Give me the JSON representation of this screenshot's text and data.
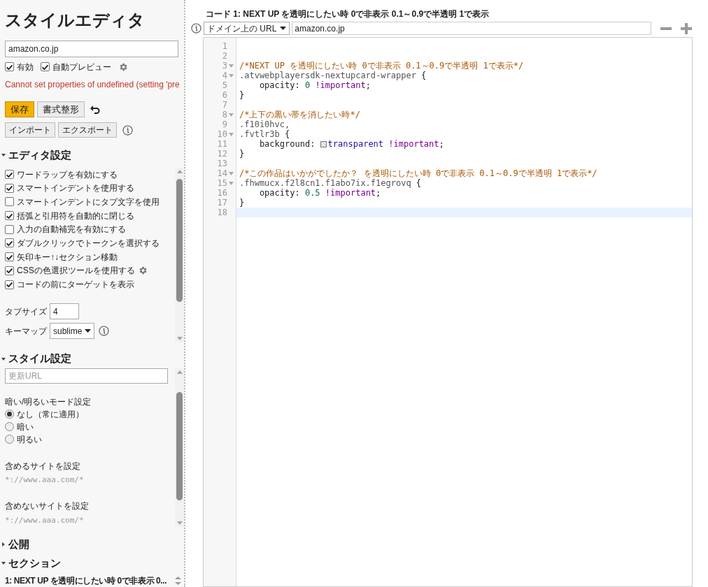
{
  "sidebar": {
    "title": "スタイルエディタ",
    "name_value": "amazon.co.jp",
    "toggles": [
      {
        "label": "有効",
        "checked": true
      },
      {
        "label": "自動プレビュー",
        "checked": true
      }
    ],
    "error": "Cannot set properties of undefined (setting 'pre",
    "buttons": [
      {
        "label": "保存",
        "kind": "primary"
      },
      {
        "label": "書式整形",
        "kind": "normal"
      }
    ],
    "io_buttons": [
      "インポート",
      "エクスポート"
    ],
    "editor_settings": {
      "title": "エディタ設定",
      "expanded": true,
      "options": [
        {
          "label": "ワードラップを有効にする",
          "checked": true,
          "gear": false
        },
        {
          "label": "スマートインデントを使用する",
          "checked": true,
          "gear": false
        },
        {
          "label": "スマートインデントにタブ文字を使用",
          "checked": false,
          "gear": false
        },
        {
          "label": "括弧と引用符を自動的に閉じる",
          "checked": true,
          "gear": false
        },
        {
          "label": "入力の自動補完を有効にする",
          "checked": false,
          "gear": false
        },
        {
          "label": "ダブルクリックでトークンを選択する",
          "checked": true,
          "gear": false
        },
        {
          "label": "矢印キー↑↓セクション移動",
          "checked": true,
          "gear": false
        },
        {
          "label": "CSSの色選択ツールを使用する",
          "checked": true,
          "gear": true
        },
        {
          "label": "コードの前にターゲットを表示",
          "checked": true,
          "gear": false
        }
      ],
      "tab_size_label": "タブサイズ",
      "tab_size": "4",
      "keymap_label": "キーマップ",
      "keymap": "sublime"
    },
    "style_settings": {
      "title": "スタイル設定",
      "expanded": true,
      "update_url_placeholder": "更新URL",
      "mode_label": "暗い/明るいモード設定",
      "modes": [
        {
          "label": "なし（常に適用）",
          "selected": true
        },
        {
          "label": "暗い",
          "selected": false
        },
        {
          "label": "明るい",
          "selected": false
        }
      ],
      "include_label": "含めるサイトを設定",
      "include_placeholder": "*://www.aaa.com/*",
      "exclude_label": "含めないサイトを設定",
      "exclude_placeholder": "*://www.aaa.com/*"
    },
    "publish": {
      "title": "公開",
      "expanded": false
    },
    "sections": {
      "title": "セクション",
      "expanded": true,
      "items": [
        "1: NEXT UP を透明にしたい時 0で非表示 0..."
      ]
    }
  },
  "editor": {
    "title": "コード 1: NEXT UP を透明にしたい時 0で非表示 0.1～0.9で半透明 1で表示",
    "applies_type": "ドメイン上の URL",
    "applies_value": "amazon.co.jp",
    "lines": [
      {
        "number": "1",
        "foldable": false,
        "active": false
      },
      {
        "number": "2",
        "foldable": false,
        "active": false
      },
      {
        "number": "3",
        "foldable": true,
        "active": false,
        "tokens": [
          {
            "kind": "comment",
            "text": "/*NEXT UP を透明にしたい時 0で非表示 0.1～0.9で半透明 1で表示*/"
          }
        ]
      },
      {
        "number": "4",
        "foldable": true,
        "active": false,
        "tokens": [
          {
            "kind": "selector",
            "text": ".atvwebplayersdk-nextupcard-wrapper"
          },
          {
            "kind": "plain",
            "text": " {"
          }
        ]
      },
      {
        "number": "5",
        "foldable": false,
        "active": false,
        "tokens": [
          {
            "kind": "plain",
            "text": "    opacity: "
          },
          {
            "kind": "number",
            "text": "0"
          },
          {
            "kind": "keyword",
            "text": "!important"
          },
          {
            "kind": "plain",
            "text": ";"
          }
        ]
      },
      {
        "number": "6",
        "foldable": false,
        "active": false,
        "tokens": [
          {
            "kind": "plain",
            "text": "}"
          }
        ]
      },
      {
        "number": "7",
        "foldable": false,
        "active": false
      },
      {
        "number": "8",
        "foldable": true,
        "active": false,
        "tokens": [
          {
            "kind": "comment",
            "text": "/*上下の黒い帯を消したい時*/"
          }
        ]
      },
      {
        "number": "9",
        "foldable": false,
        "active": false,
        "tokens": [
          {
            "kind": "selector",
            "text": ".f10i0hvc,"
          }
        ]
      },
      {
        "number": "10",
        "foldable": true,
        "active": false,
        "tokens": [
          {
            "kind": "selector",
            "text": ".fvtlr3b"
          },
          {
            "kind": "plain",
            "text": " {"
          }
        ]
      },
      {
        "number": "11",
        "foldable": false,
        "active": false,
        "tokens": [
          {
            "kind": "plain",
            "text": "    background: "
          },
          {
            "kind": "swatch"
          },
          {
            "kind": "atom",
            "text": "transparent"
          },
          {
            "kind": "keyword",
            "text": "!important"
          },
          {
            "kind": "plain",
            "text": ";"
          }
        ]
      },
      {
        "number": "12",
        "foldable": false,
        "active": false,
        "tokens": [
          {
            "kind": "plain",
            "text": "}"
          }
        ]
      },
      {
        "number": "13",
        "foldable": false,
        "active": false
      },
      {
        "number": "14",
        "foldable": true,
        "active": false,
        "tokens": [
          {
            "kind": "comment",
            "text": "/*この作品はいかがでしたか？ を透明にしたい時 0で非表示 0.1～0.9で半透明 1で表示*/"
          }
        ]
      },
      {
        "number": "15",
        "foldable": true,
        "active": false,
        "tokens": [
          {
            "kind": "selector",
            "text": ".fhwmucx.f2l8cn1.f1abo7ix.f1egrovq"
          },
          {
            "kind": "plain",
            "text": " {"
          }
        ]
      },
      {
        "number": "16",
        "foldable": false,
        "active": false,
        "tokens": [
          {
            "kind": "plain",
            "text": "    opacity: "
          },
          {
            "kind": "number",
            "text": "0.5"
          },
          {
            "kind": "keyword",
            "text": "!important"
          },
          {
            "kind": "plain",
            "text": ";"
          }
        ]
      },
      {
        "number": "17",
        "foldable": false,
        "active": false,
        "tokens": [
          {
            "kind": "plain",
            "text": "}"
          }
        ]
      },
      {
        "number": "18",
        "foldable": false,
        "active": true
      }
    ]
  }
}
